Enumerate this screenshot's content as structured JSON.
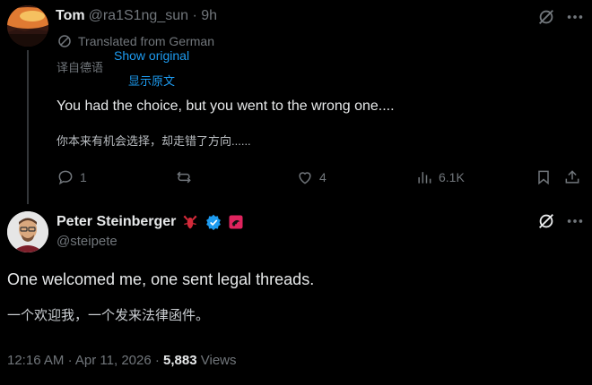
{
  "reply": {
    "name": "Tom",
    "handle": "@ra1S1ng_sun",
    "separator": "·",
    "time": "9h",
    "translated_label": "Translated from German",
    "translate_annot_1": "译自德语",
    "show_original": "Show original",
    "translate_annot_2": "显示原文",
    "text": "You had the choice, but you went to the wrong one....",
    "text_cn": "你本来有机会选择，却走错了方向......",
    "actions": {
      "replies": "1",
      "retweets": "",
      "likes": "4",
      "views": "6.1K"
    }
  },
  "main": {
    "name": "Peter Steinberger",
    "handle": "@steipete",
    "text": "One welcomed me, one sent legal threads.",
    "text_cn": "一个欢迎我，一个发来法律函件。",
    "time": "12:16 AM",
    "date": "Apr 11, 2026",
    "sep": "·",
    "views_count": "5,883",
    "views_label": "Views"
  },
  "colors": {
    "accent": "#1d9bf0",
    "muted": "#71767b",
    "text": "#e7e9ea",
    "background": "#000000",
    "lobster": "#e0245e"
  },
  "icons": [
    "translate-icon",
    "grok-icon",
    "more-icon",
    "reply-icon",
    "retweet-icon",
    "like-icon",
    "views-icon",
    "bookmark-icon",
    "share-icon",
    "lobster-emoji-icon",
    "verified-badge-icon",
    "affiliate-badge-icon"
  ]
}
